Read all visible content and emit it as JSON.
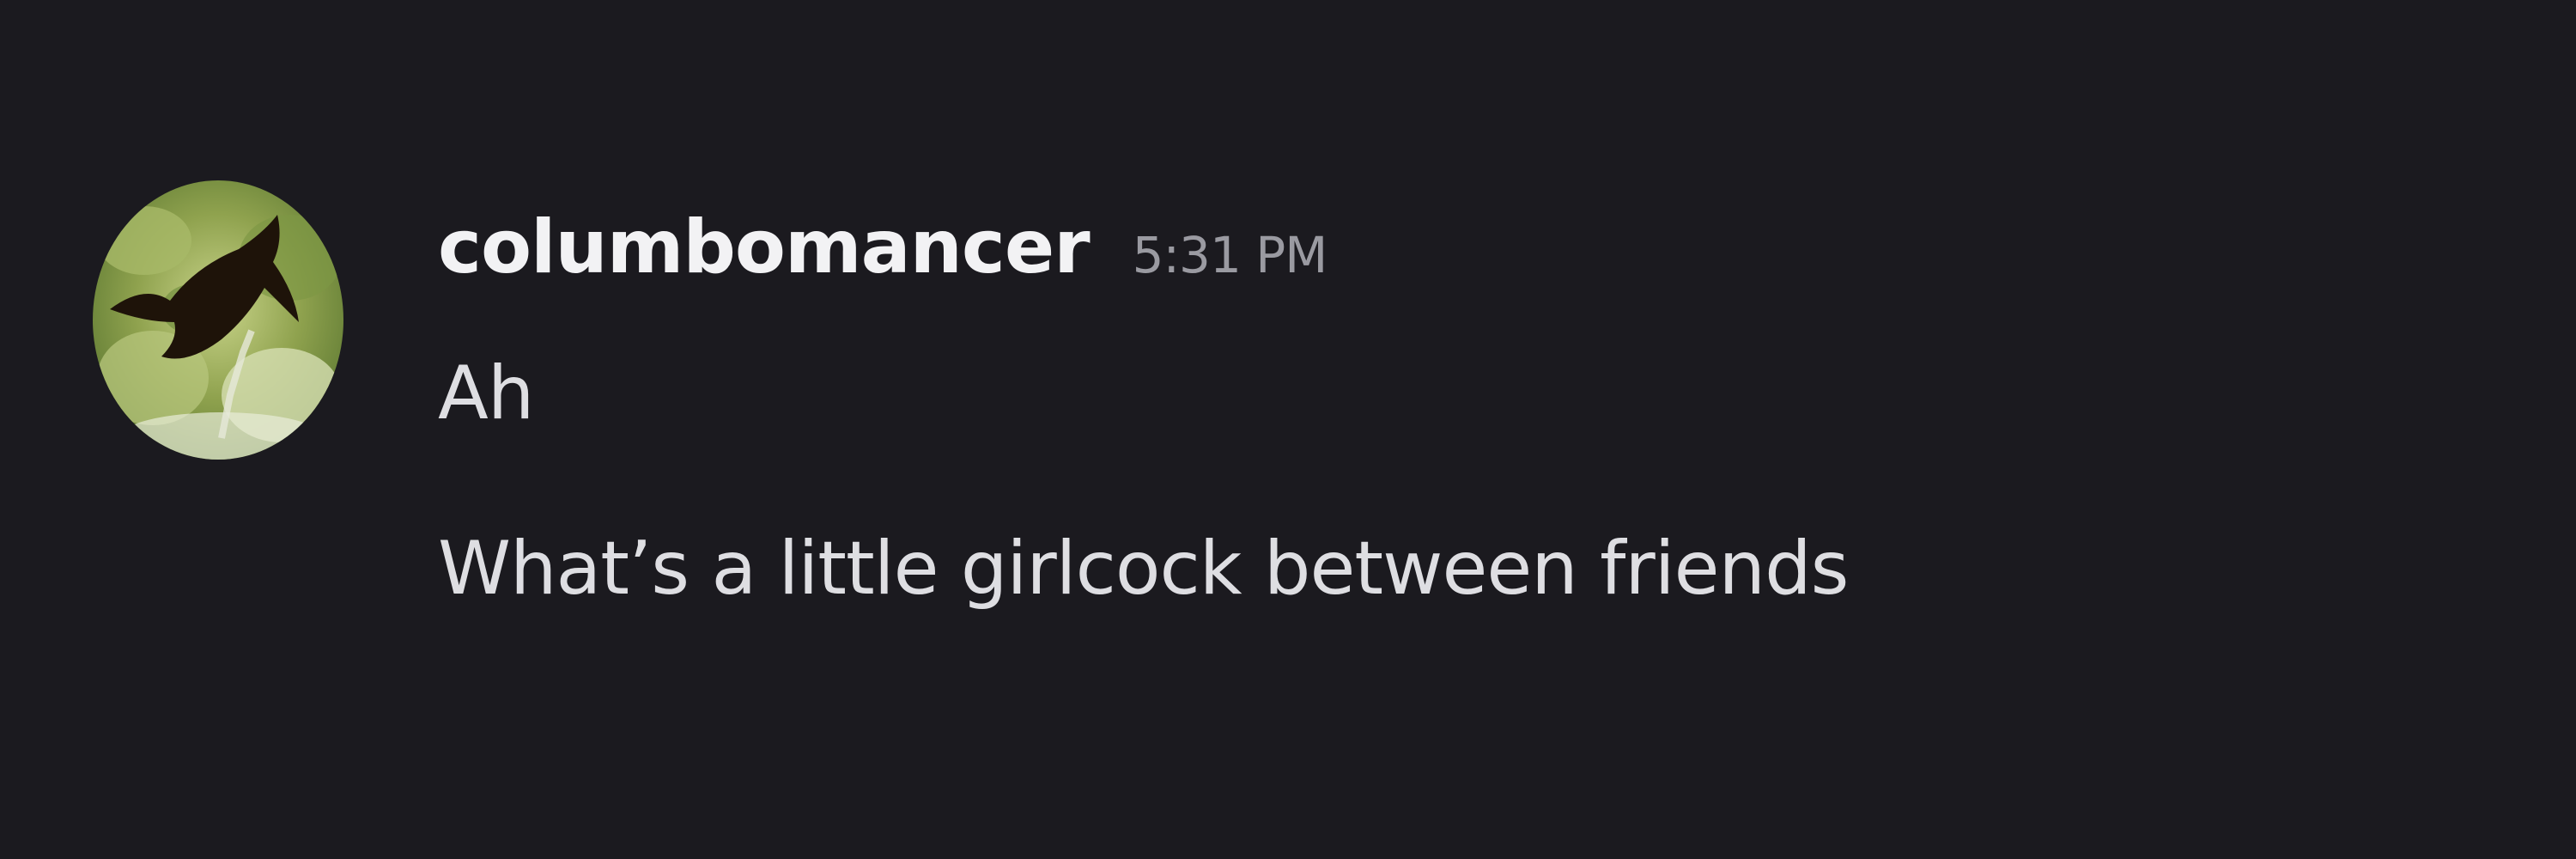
{
  "message": {
    "username": "columbomancer",
    "timestamp": "5:31 PM",
    "lines": [
      "Ah",
      "What’s a little girlcock between friends"
    ],
    "avatar_icon": "user-avatar-icon"
  },
  "colors": {
    "background": "#1b1a1f",
    "username": "#f2f2f4",
    "timestamp": "#9a9aa1",
    "message_text": "#dedee2"
  }
}
